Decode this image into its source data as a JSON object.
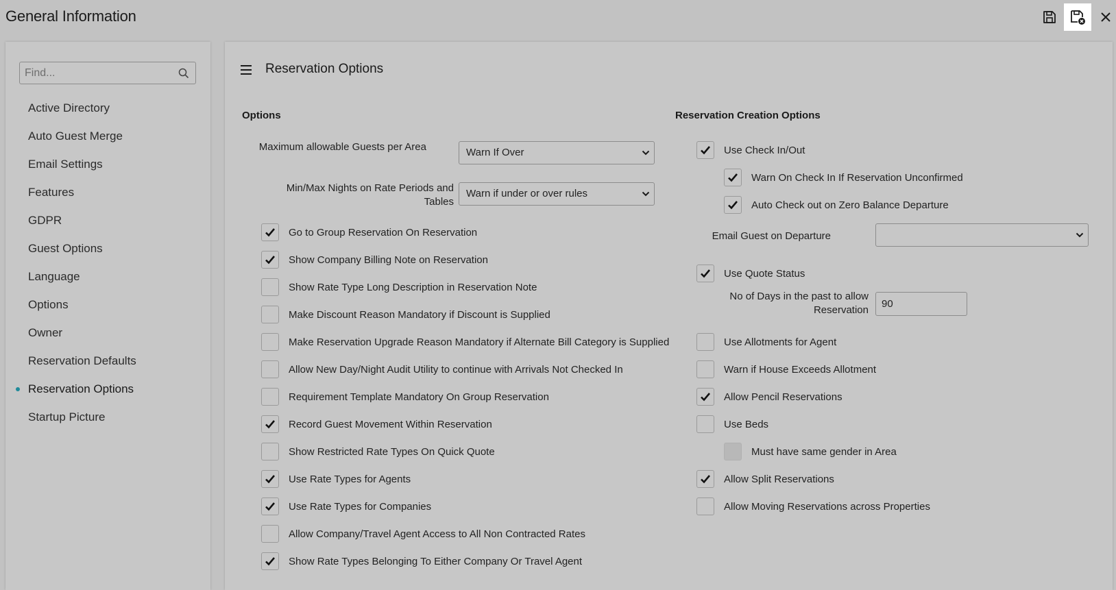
{
  "window": {
    "title": "General Information",
    "actions": {
      "save_icon": "save-icon",
      "save_close_icon": "save-close-icon",
      "close_icon": "close-icon"
    }
  },
  "sidebar": {
    "search": {
      "placeholder": "Find...",
      "value": ""
    },
    "items": [
      {
        "label": "Active Directory",
        "active": false
      },
      {
        "label": "Auto Guest Merge",
        "active": false
      },
      {
        "label": "Email Settings",
        "active": false
      },
      {
        "label": "Features",
        "active": false
      },
      {
        "label": "GDPR",
        "active": false
      },
      {
        "label": "Guest Options",
        "active": false
      },
      {
        "label": "Language",
        "active": false
      },
      {
        "label": "Options",
        "active": false
      },
      {
        "label": "Owner",
        "active": false
      },
      {
        "label": "Reservation Defaults",
        "active": false
      },
      {
        "label": "Reservation Options",
        "active": true
      },
      {
        "label": "Startup Picture",
        "active": false
      }
    ]
  },
  "main": {
    "title": "Reservation Options",
    "options": {
      "title": "Options",
      "max_guests": {
        "label": "Maximum allowable Guests per Area",
        "value": "Warn If Over"
      },
      "min_max_nights": {
        "label_line1": "Min/Max Nights on Rate Periods and",
        "label_line2": "Tables",
        "value": "Warn if under or over rules"
      },
      "checkboxes": [
        {
          "label": "Go to Group Reservation On Reservation",
          "checked": true
        },
        {
          "label": "Show Company Billing Note on Reservation",
          "checked": true
        },
        {
          "label": "Show Rate Type Long Description in Reservation Note",
          "checked": false
        },
        {
          "label": "Make Discount Reason Mandatory if Discount is Supplied",
          "checked": false
        },
        {
          "label": "Make Reservation Upgrade Reason Mandatory if Alternate Bill Category is Supplied",
          "checked": false
        },
        {
          "label": "Allow New Day/Night Audit Utility to continue with Arrivals Not Checked In",
          "checked": false
        },
        {
          "label": "Requirement Template Mandatory On Group Reservation",
          "checked": false
        },
        {
          "label": "Record Guest Movement Within Reservation",
          "checked": true
        },
        {
          "label": "Show Restricted Rate Types On Quick Quote",
          "checked": false
        },
        {
          "label": "Use Rate Types for Agents",
          "checked": true
        },
        {
          "label": "Use Rate Types for Companies",
          "checked": true
        },
        {
          "label": "Allow Company/Travel Agent Access to All Non Contracted Rates",
          "checked": false
        },
        {
          "label": "Show Rate Types Belonging To Either Company Or Travel Agent",
          "checked": true
        }
      ]
    },
    "creation": {
      "title": "Reservation Creation Options",
      "use_check_in_out": {
        "label": "Use Check In/Out",
        "checked": true
      },
      "warn_unconfirmed": {
        "label": "Warn On Check In If Reservation Unconfirmed",
        "checked": true
      },
      "auto_check_out": {
        "label": "Auto Check out on Zero Balance Departure",
        "checked": true
      },
      "email_guest": {
        "label": "Email Guest on Departure",
        "value": ""
      },
      "use_quote_status": {
        "label": "Use Quote Status",
        "checked": true
      },
      "days_past": {
        "label_line1": "No of Days in the past to allow",
        "label_line2": "Reservation",
        "value": "90"
      },
      "use_allotments": {
        "label": "Use Allotments for Agent",
        "checked": false
      },
      "warn_house": {
        "label": "Warn if House Exceeds Allotment",
        "checked": false
      },
      "allow_pencil": {
        "label": "Allow Pencil Reservations",
        "checked": true
      },
      "use_beds": {
        "label": "Use Beds",
        "checked": false
      },
      "same_gender": {
        "label": "Must have same gender in Area",
        "checked": false,
        "disabled": true
      },
      "allow_split": {
        "label": "Allow Split Reservations",
        "checked": true
      },
      "allow_moving": {
        "label": "Allow Moving Reservations across Properties",
        "checked": false
      }
    }
  }
}
